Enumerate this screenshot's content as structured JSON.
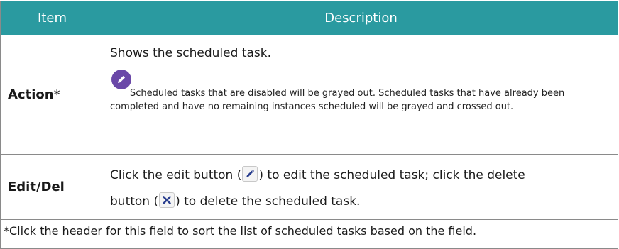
{
  "header": {
    "col_item": "Item",
    "col_description": "Description"
  },
  "rows": [
    {
      "item": "Action",
      "item_suffix": "*",
      "description": "Shows the scheduled task.",
      "note_icon": "pencil-note-icon",
      "note": "Scheduled tasks that are disabled will be grayed out. Scheduled tasks that have already been completed and have no remaining instances scheduled will be grayed and crossed out."
    },
    {
      "item": "Edit/Del",
      "desc_part1": "Click the edit button (",
      "desc_part2": ") to edit the scheduled task; click the delete",
      "desc_part3": "button (",
      "desc_part4": ") to delete the scheduled task.",
      "edit_icon": "pencil-icon",
      "delete_icon": "x-icon"
    }
  ],
  "footnote": "*Click the header for this field to sort the list of scheduled tasks based on the field.",
  "colors": {
    "header_bg": "#2a9aa0",
    "header_text": "#ffffff",
    "note_icon_bg": "#6a48a8",
    "border": "#8a8a8a"
  }
}
